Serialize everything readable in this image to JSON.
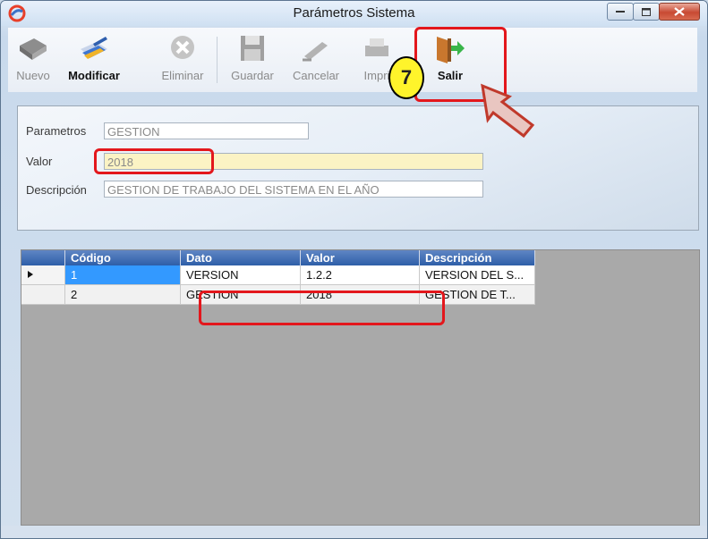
{
  "window": {
    "title": "Parámetros Sistema"
  },
  "toolbar": {
    "items": [
      {
        "label": "Nuevo",
        "icon": "book-icon",
        "enabled": false
      },
      {
        "label": "Modificar",
        "icon": "edit-pen-icon",
        "enabled": true
      },
      {
        "label": "Eliminar",
        "icon": "delete-x-icon",
        "enabled": false
      },
      {
        "label": "Guardar",
        "icon": "save-disk-icon",
        "enabled": false
      },
      {
        "label": "Cancelar",
        "icon": "cancel-pen-icon",
        "enabled": false
      },
      {
        "label": "Impri",
        "icon": "printer-icon",
        "enabled": false
      },
      {
        "label": "Salir",
        "icon": "exit-door-icon",
        "enabled": true
      }
    ]
  },
  "form": {
    "parametros_label": "Parametros",
    "parametros_value": "GESTION",
    "valor_label": "Valor",
    "valor_value": "2018",
    "descripcion_label": "Descripción",
    "descripcion_value": "GESTION DE TRABAJO DEL SISTEMA EN EL AÑO"
  },
  "grid": {
    "columns": [
      "Código",
      "Dato",
      "Valor",
      "Descripción"
    ],
    "rows": [
      {
        "codigo": "1",
        "dato": "VERSION",
        "valor": "1.2.2",
        "descripcion": "VERSION DEL S..."
      },
      {
        "codigo": "2",
        "dato": "GESTION",
        "valor": "2018",
        "descripcion": "GESTION DE T..."
      }
    ]
  },
  "annotation": {
    "step_number": "7",
    "highlight_color": "#e3171c",
    "badge_color": "#fff42b"
  }
}
